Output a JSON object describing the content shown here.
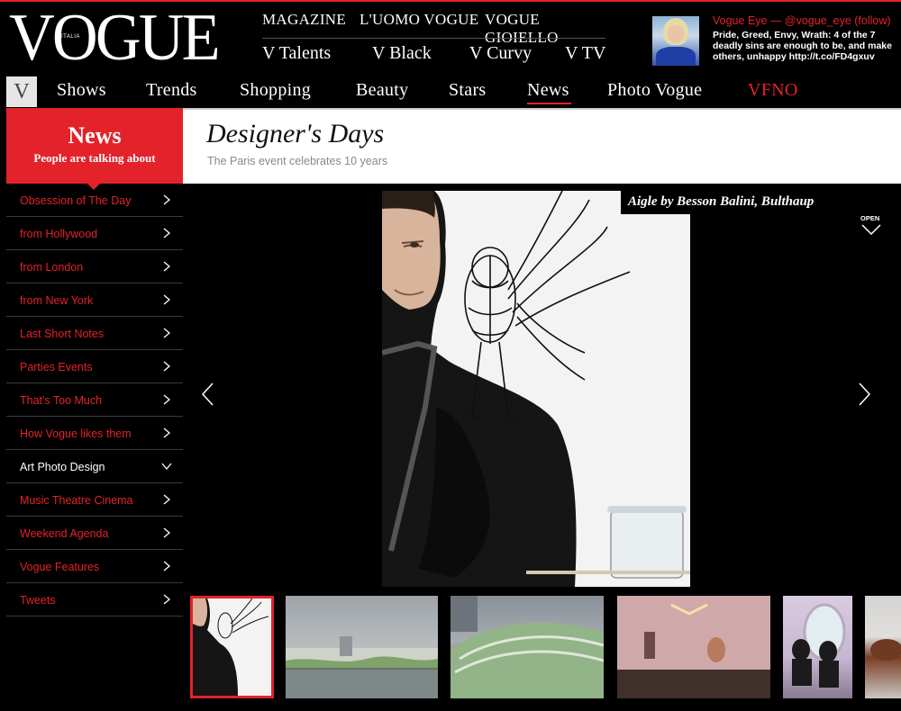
{
  "logo": {
    "text": "VOGUE",
    "subtext": "ITALIA"
  },
  "top_nav_row1": [
    "MAGAZINE",
    "L'UOMO VOGUE",
    "VOGUE GIOIELLO"
  ],
  "top_nav_row2": [
    "V Talents",
    "V Black",
    "V Curvy",
    "V TV"
  ],
  "vogue_eye": {
    "title": "Vogue Eye — @vogue_eye (follow)",
    "tweet": "Pride, Greed, Envy, Wrath: 4 of the 7 deadly sins are enough to be, and make others, unhappy http://t.co/FD4gxuv"
  },
  "main_nav": {
    "home_label": "V",
    "items": [
      "Shows",
      "Trends",
      "Shopping",
      "Beauty",
      "Stars",
      "News",
      "Photo Vogue",
      "VFNO"
    ],
    "active": "News"
  },
  "section": {
    "title": "News",
    "subtitle": "People are talking about"
  },
  "article": {
    "title": "Designer's Days",
    "subtitle": "The Paris event celebrates 10 years"
  },
  "sidebar": {
    "items": [
      {
        "label": "Obsession of The Day",
        "expanded": false
      },
      {
        "label": "from Hollywood",
        "expanded": false
      },
      {
        "label": "from London",
        "expanded": false
      },
      {
        "label": "from New York",
        "expanded": false
      },
      {
        "label": "Last Short Notes",
        "expanded": false
      },
      {
        "label": "Parties Events",
        "expanded": false
      },
      {
        "label": "That's Too Much",
        "expanded": false
      },
      {
        "label": "How Vogue likes them",
        "expanded": false
      },
      {
        "label": "Art Photo Design",
        "expanded": true
      },
      {
        "label": "Music Theatre Cinema",
        "expanded": false
      },
      {
        "label": "Weekend Agenda",
        "expanded": false
      },
      {
        "label": "Vogue Features",
        "expanded": false
      },
      {
        "label": "Tweets",
        "expanded": false
      }
    ]
  },
  "gallery": {
    "caption": "Aigle by Besson Balini, Bulthaup",
    "open_label": "OPEN",
    "thumbnail_count": 6,
    "selected_thumbnail": 1
  },
  "colors": {
    "accent": "#e4222a",
    "background": "#000000",
    "text": "#ffffff"
  }
}
